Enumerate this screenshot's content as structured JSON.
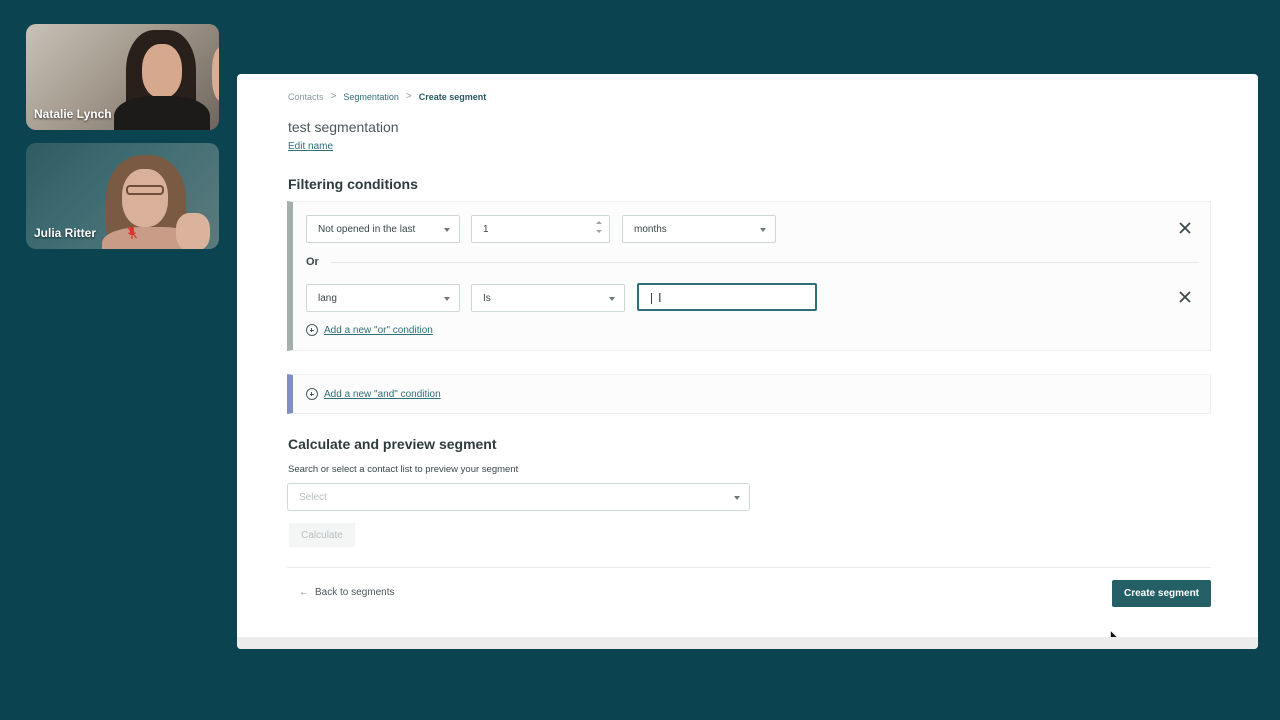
{
  "participants": [
    {
      "name": "Natalie Lynch",
      "muted": false
    },
    {
      "name": "Julia Ritter",
      "muted": true
    }
  ],
  "breadcrumb": {
    "items": [
      "Contacts",
      "Segmentation",
      "Create segment"
    ],
    "separator": ">"
  },
  "segment": {
    "name": "test segmentation",
    "edit_name_label": "Edit name"
  },
  "filtering": {
    "title": "Filtering conditions",
    "or_label": "Or",
    "conditions": [
      {
        "field": "Not opened in the last",
        "value": "1",
        "unit": "months"
      },
      {
        "field": "lang",
        "operator": "Is",
        "value": ""
      }
    ],
    "add_or_label": "Add a new \"or\" condition",
    "add_and_label": "Add a new \"and\" condition"
  },
  "calculate": {
    "title": "Calculate and preview segment",
    "preview_label": "Search or select a contact list to preview your segment",
    "select_placeholder": "Select",
    "calculate_label": "Calculate"
  },
  "footer": {
    "back_label": "Back to segments",
    "create_label": "Create segment"
  },
  "colors": {
    "background": "#0b4350",
    "accent": "#245f65",
    "or_group_bar": "#a3ada9",
    "and_group_bar": "#7f8fc4"
  },
  "icons": [
    "chevron-right-icon",
    "caret-down-icon",
    "close-icon",
    "plus-circle-icon",
    "arrow-left-icon",
    "mic-muted-icon",
    "mouse-pointer-icon"
  ]
}
